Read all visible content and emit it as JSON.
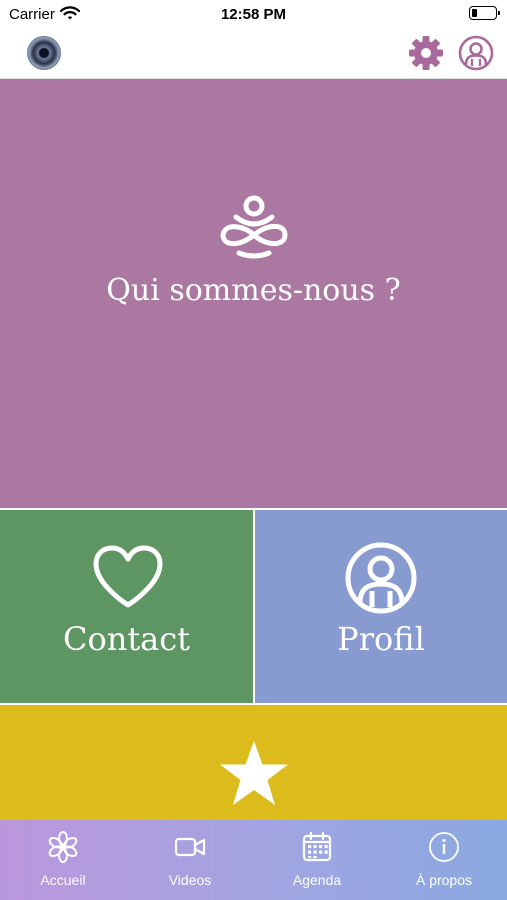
{
  "status_bar": {
    "carrier": "Carrier",
    "time": "12:58 PM"
  },
  "nav": {
    "settings_icon": "gear-icon",
    "account_icon": "user-circle-icon"
  },
  "tiles": {
    "about": {
      "label": "Qui sommes-nous ?",
      "icon": "meditation-icon",
      "color": "#ab78a2"
    },
    "contact": {
      "label": "Contact",
      "icon": "heart-icon",
      "color": "#5e9663"
    },
    "profile": {
      "label": "Profil",
      "icon": "user-circle-icon",
      "color": "#879bd0"
    },
    "favorites": {
      "icon": "star-icon",
      "color": "#dcbc1c"
    }
  },
  "tabs": [
    {
      "label": "Accueil",
      "icon": "flower-icon"
    },
    {
      "label": "Videos",
      "icon": "video-camera-icon"
    },
    {
      "label": "Agenda",
      "icon": "calendar-icon"
    },
    {
      "label": "À propos",
      "icon": "info-icon"
    }
  ],
  "colors": {
    "accent": "#a8699c",
    "tab_gradient_start": "#bb97dc",
    "tab_gradient_end": "#8aa8e0"
  }
}
